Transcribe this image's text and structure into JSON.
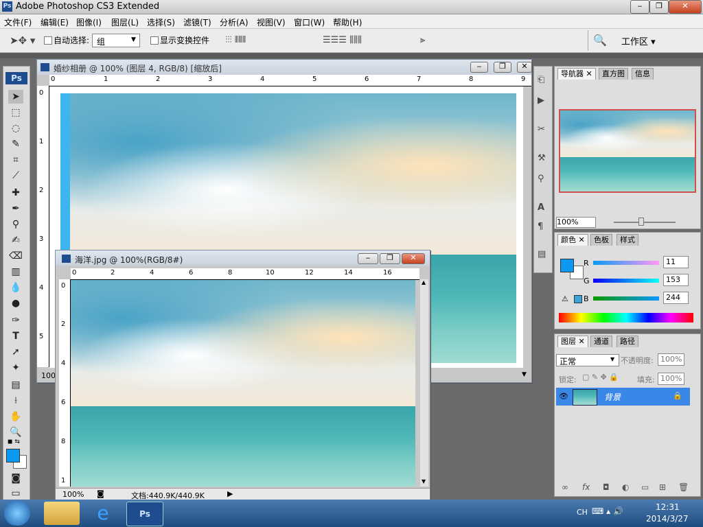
{
  "app": {
    "title": "Adobe Photoshop CS3 Extended",
    "ps_badge": "Ps"
  },
  "menu": [
    "文件(F)",
    "编辑(E)",
    "图像(I)",
    "图层(L)",
    "选择(S)",
    "滤镜(T)",
    "分析(A)",
    "视图(V)",
    "窗口(W)",
    "帮助(H)"
  ],
  "options": {
    "auto_select_label": "自动选择:",
    "auto_select_value": "组",
    "show_transform_label": "显示变换控件",
    "workspace_label": "工作区 ▾"
  },
  "doc1": {
    "title": "婚纱相册 @ 100% (图层 4, RGB/8) [缩放后]",
    "ruler_h": [
      "0",
      "1",
      "2",
      "3",
      "4",
      "5",
      "6",
      "7",
      "8",
      "9"
    ],
    "ruler_v": [
      "0",
      "1",
      "2",
      "3",
      "4",
      "5"
    ],
    "zoom": "100"
  },
  "doc2": {
    "title": "海洋.jpg @ 100%(RGB/8#)",
    "ruler_h": [
      "0",
      "2",
      "4",
      "6",
      "8",
      "10",
      "12",
      "14",
      "16"
    ],
    "ruler_v": [
      "0",
      "2",
      "4",
      "6",
      "8",
      "1"
    ],
    "zoom": "100%",
    "doc_info": "文档:440.9K/440.9K"
  },
  "navigator": {
    "tabs": [
      "导航器",
      "直方图",
      "信息"
    ],
    "zoom": "100%"
  },
  "color": {
    "tabs": [
      "颜色",
      "色板",
      "样式"
    ],
    "r_label": "R",
    "g_label": "G",
    "b_label": "B",
    "r": "11",
    "g": "153",
    "b": "244",
    "fg_color": "#0b99f4"
  },
  "layers": {
    "tabs": [
      "图层",
      "通道",
      "路径"
    ],
    "blend_mode": "正常",
    "opacity_label": "不透明度:",
    "opacity": "100%",
    "lock_label": "锁定:",
    "fill_label": "填充:",
    "fill": "100%",
    "layer_name": "背景"
  },
  "taskbar": {
    "lang": "CH",
    "time": "12:31",
    "date": "2014/3/27"
  }
}
